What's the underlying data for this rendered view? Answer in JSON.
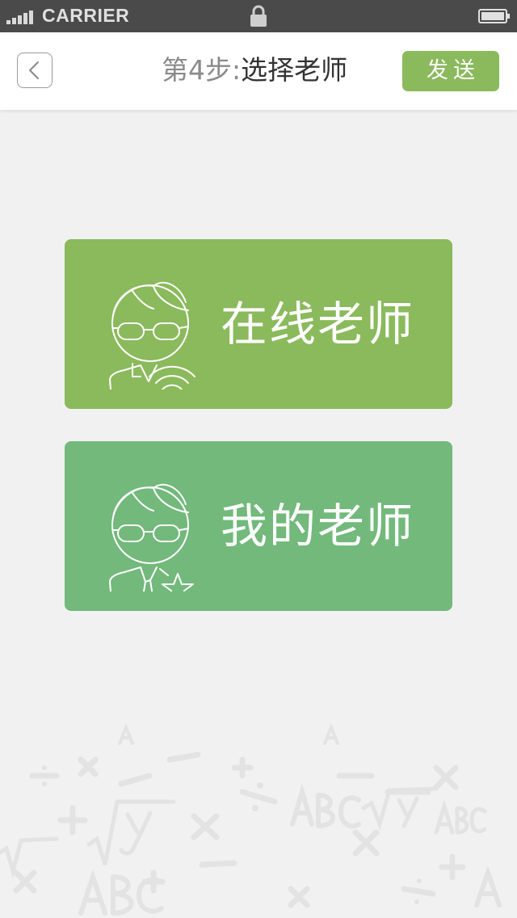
{
  "status_bar": {
    "carrier": "CARRIER",
    "signal_icon": "signal-bars-icon",
    "lock_icon": "lock-icon",
    "battery_icon": "battery-icon"
  },
  "nav": {
    "back_icon": "chevron-left-icon",
    "title_step": "第4步",
    "title_separator": ":",
    "title_main": "选择老师",
    "send_label": "发送"
  },
  "cards": [
    {
      "label": "在线老师",
      "icon": "teacher-wifi-icon",
      "color": "#8aba5c"
    },
    {
      "label": "我的老师",
      "icon": "teacher-star-icon",
      "color": "#72b97b"
    }
  ],
  "colors": {
    "status_bar": "#4a4a4a",
    "background": "#f1f1f1",
    "accent_green": "#8aba5c",
    "secondary_green": "#72b97b"
  }
}
